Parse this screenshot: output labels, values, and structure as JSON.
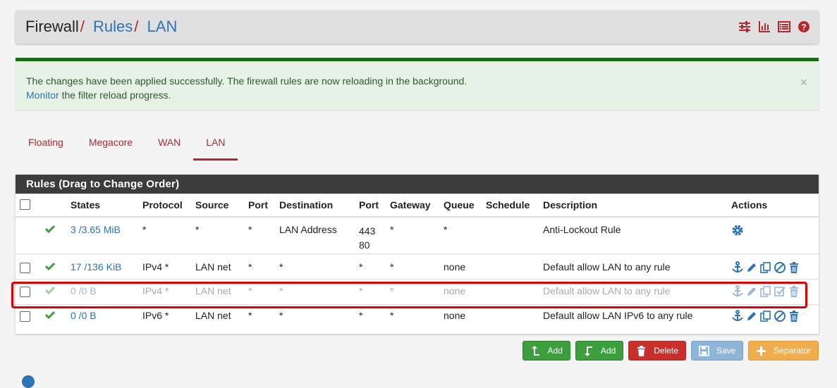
{
  "breadcrumb": {
    "items": [
      "Firewall",
      "Rules",
      "LAN"
    ],
    "separator": "/"
  },
  "header_icons": [
    "sliders-icon",
    "bar-chart-icon",
    "list-icon",
    "help-icon"
  ],
  "alert": {
    "line1": "The changes have been applied successfully. The firewall rules are now reloading in the background.",
    "monitor_link": "Monitor",
    "line2_rest": " the filter reload progress.",
    "close": "×"
  },
  "tabs": [
    {
      "label": "Floating",
      "active": false
    },
    {
      "label": "Megacore",
      "active": false
    },
    {
      "label": "WAN",
      "active": false
    },
    {
      "label": "LAN",
      "active": true
    }
  ],
  "panel": {
    "title": "Rules (Drag to Change Order)"
  },
  "columns": {
    "states": "States",
    "protocol": "Protocol",
    "source": "Source",
    "port": "Port",
    "destination": "Destination",
    "dport": "Port",
    "gateway": "Gateway",
    "queue": "Queue",
    "schedule": "Schedule",
    "description": "Description",
    "actions": "Actions"
  },
  "rows": [
    {
      "checkbox": false,
      "status": "enabled",
      "states": "3 /3.65 MiB",
      "protocol": "*",
      "source": "*",
      "port": "*",
      "destination": "LAN Address",
      "dport_line1": "443",
      "dport_line2": "80",
      "gateway": "*",
      "queue": "*",
      "schedule": "",
      "description": "Anti-Lockout Rule",
      "actions": [
        "gear-icon"
      ]
    },
    {
      "checkbox": true,
      "status": "enabled",
      "states": "17 /136 KiB",
      "protocol": "IPv4 *",
      "source": "LAN net",
      "port": "*",
      "destination": "*",
      "dport": "*",
      "gateway": "*",
      "queue": "none",
      "schedule": "",
      "description": "Default allow LAN to any rule",
      "actions": [
        "anchor-icon",
        "pencil-icon",
        "copy-icon",
        "disable-icon",
        "trash-icon"
      ]
    },
    {
      "checkbox": true,
      "status": "disabled",
      "states": "0 /0 B",
      "protocol": "IPv4 *",
      "source": "LAN net",
      "port": "*",
      "destination": "*",
      "dport": "*",
      "gateway": "*",
      "queue": "none",
      "schedule": "",
      "description": "Default allow LAN to any rule",
      "actions": [
        "anchor-icon",
        "pencil-icon",
        "copy-icon",
        "enable-check-icon",
        "trash-icon"
      ]
    },
    {
      "checkbox": true,
      "status": "enabled",
      "states": "0 /0 B",
      "protocol": "IPv6 *",
      "source": "LAN net",
      "port": "*",
      "destination": "*",
      "dport": "*",
      "gateway": "*",
      "queue": "none",
      "schedule": "",
      "description": "Default allow LAN IPv6 to any rule",
      "actions": [
        "anchor-icon",
        "pencil-icon",
        "copy-icon",
        "disable-icon",
        "trash-icon"
      ]
    }
  ],
  "buttons": {
    "add_top": "Add",
    "add_bottom": "Add",
    "delete": "Delete",
    "save": "Save",
    "separator": "Separator"
  },
  "colors": {
    "accent_red": "#b5272d",
    "link_blue": "#2c74b3",
    "success_green": "#3c9e3c",
    "alert_border": "#1b6b1b",
    "highlight": "#e00000"
  }
}
